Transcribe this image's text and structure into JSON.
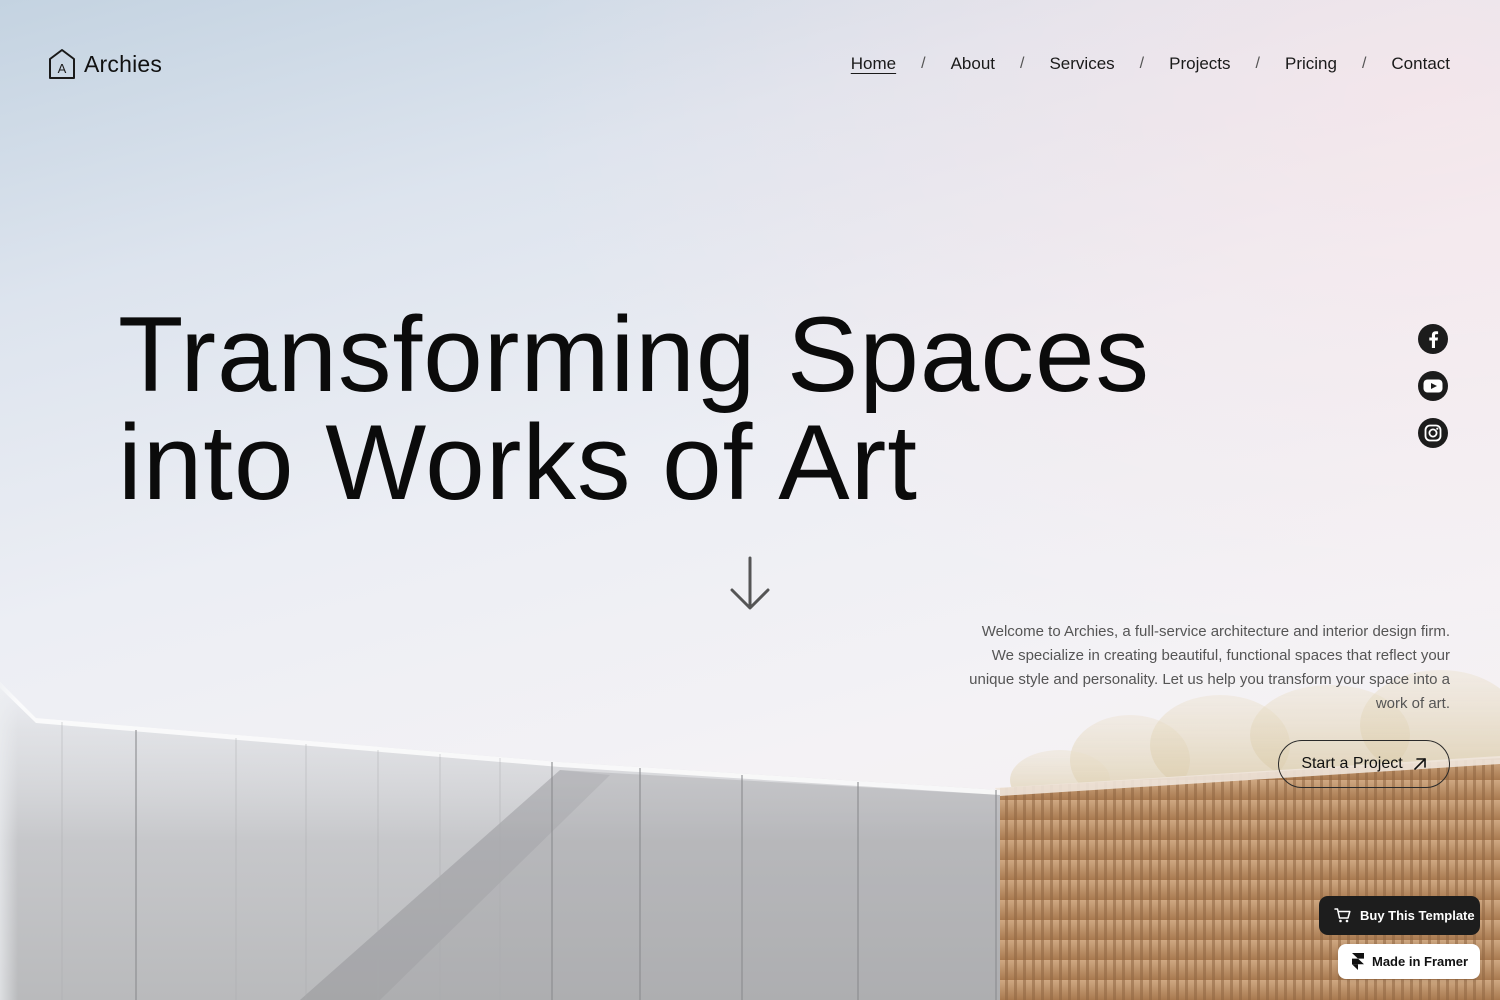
{
  "brand": {
    "logo_letter": "A",
    "name": "Archies"
  },
  "nav": {
    "items": [
      {
        "label": "Home",
        "active": true
      },
      {
        "label": "About",
        "active": false
      },
      {
        "label": "Services",
        "active": false
      },
      {
        "label": "Projects",
        "active": false
      },
      {
        "label": "Pricing",
        "active": false
      },
      {
        "label": "Contact",
        "active": false
      }
    ],
    "separator": "/"
  },
  "hero": {
    "headline_line1": "Transforming Spaces",
    "headline_line2": "into Works of Art",
    "scroll_icon": "arrow-down-icon",
    "intro": "Welcome to Archies, a full-service architecture and interior design firm. We specialize in creating beautiful, functional spaces that reflect your unique style and personality. Let us help you transform your space into a work of art.",
    "cta_label": "Start a Project",
    "cta_icon": "arrow-up-right-icon"
  },
  "socials": [
    {
      "icon": "facebook-icon"
    },
    {
      "icon": "youtube-icon"
    },
    {
      "icon": "instagram-icon"
    }
  ],
  "badges": {
    "buy_label": "Buy This Template",
    "buy_icon": "cart-icon",
    "framer_label": "Made in Framer",
    "framer_icon": "framer-logo-icon"
  },
  "colors": {
    "text": "#111111",
    "muted": "#555555",
    "dark_badge": "#1d1d1d"
  }
}
